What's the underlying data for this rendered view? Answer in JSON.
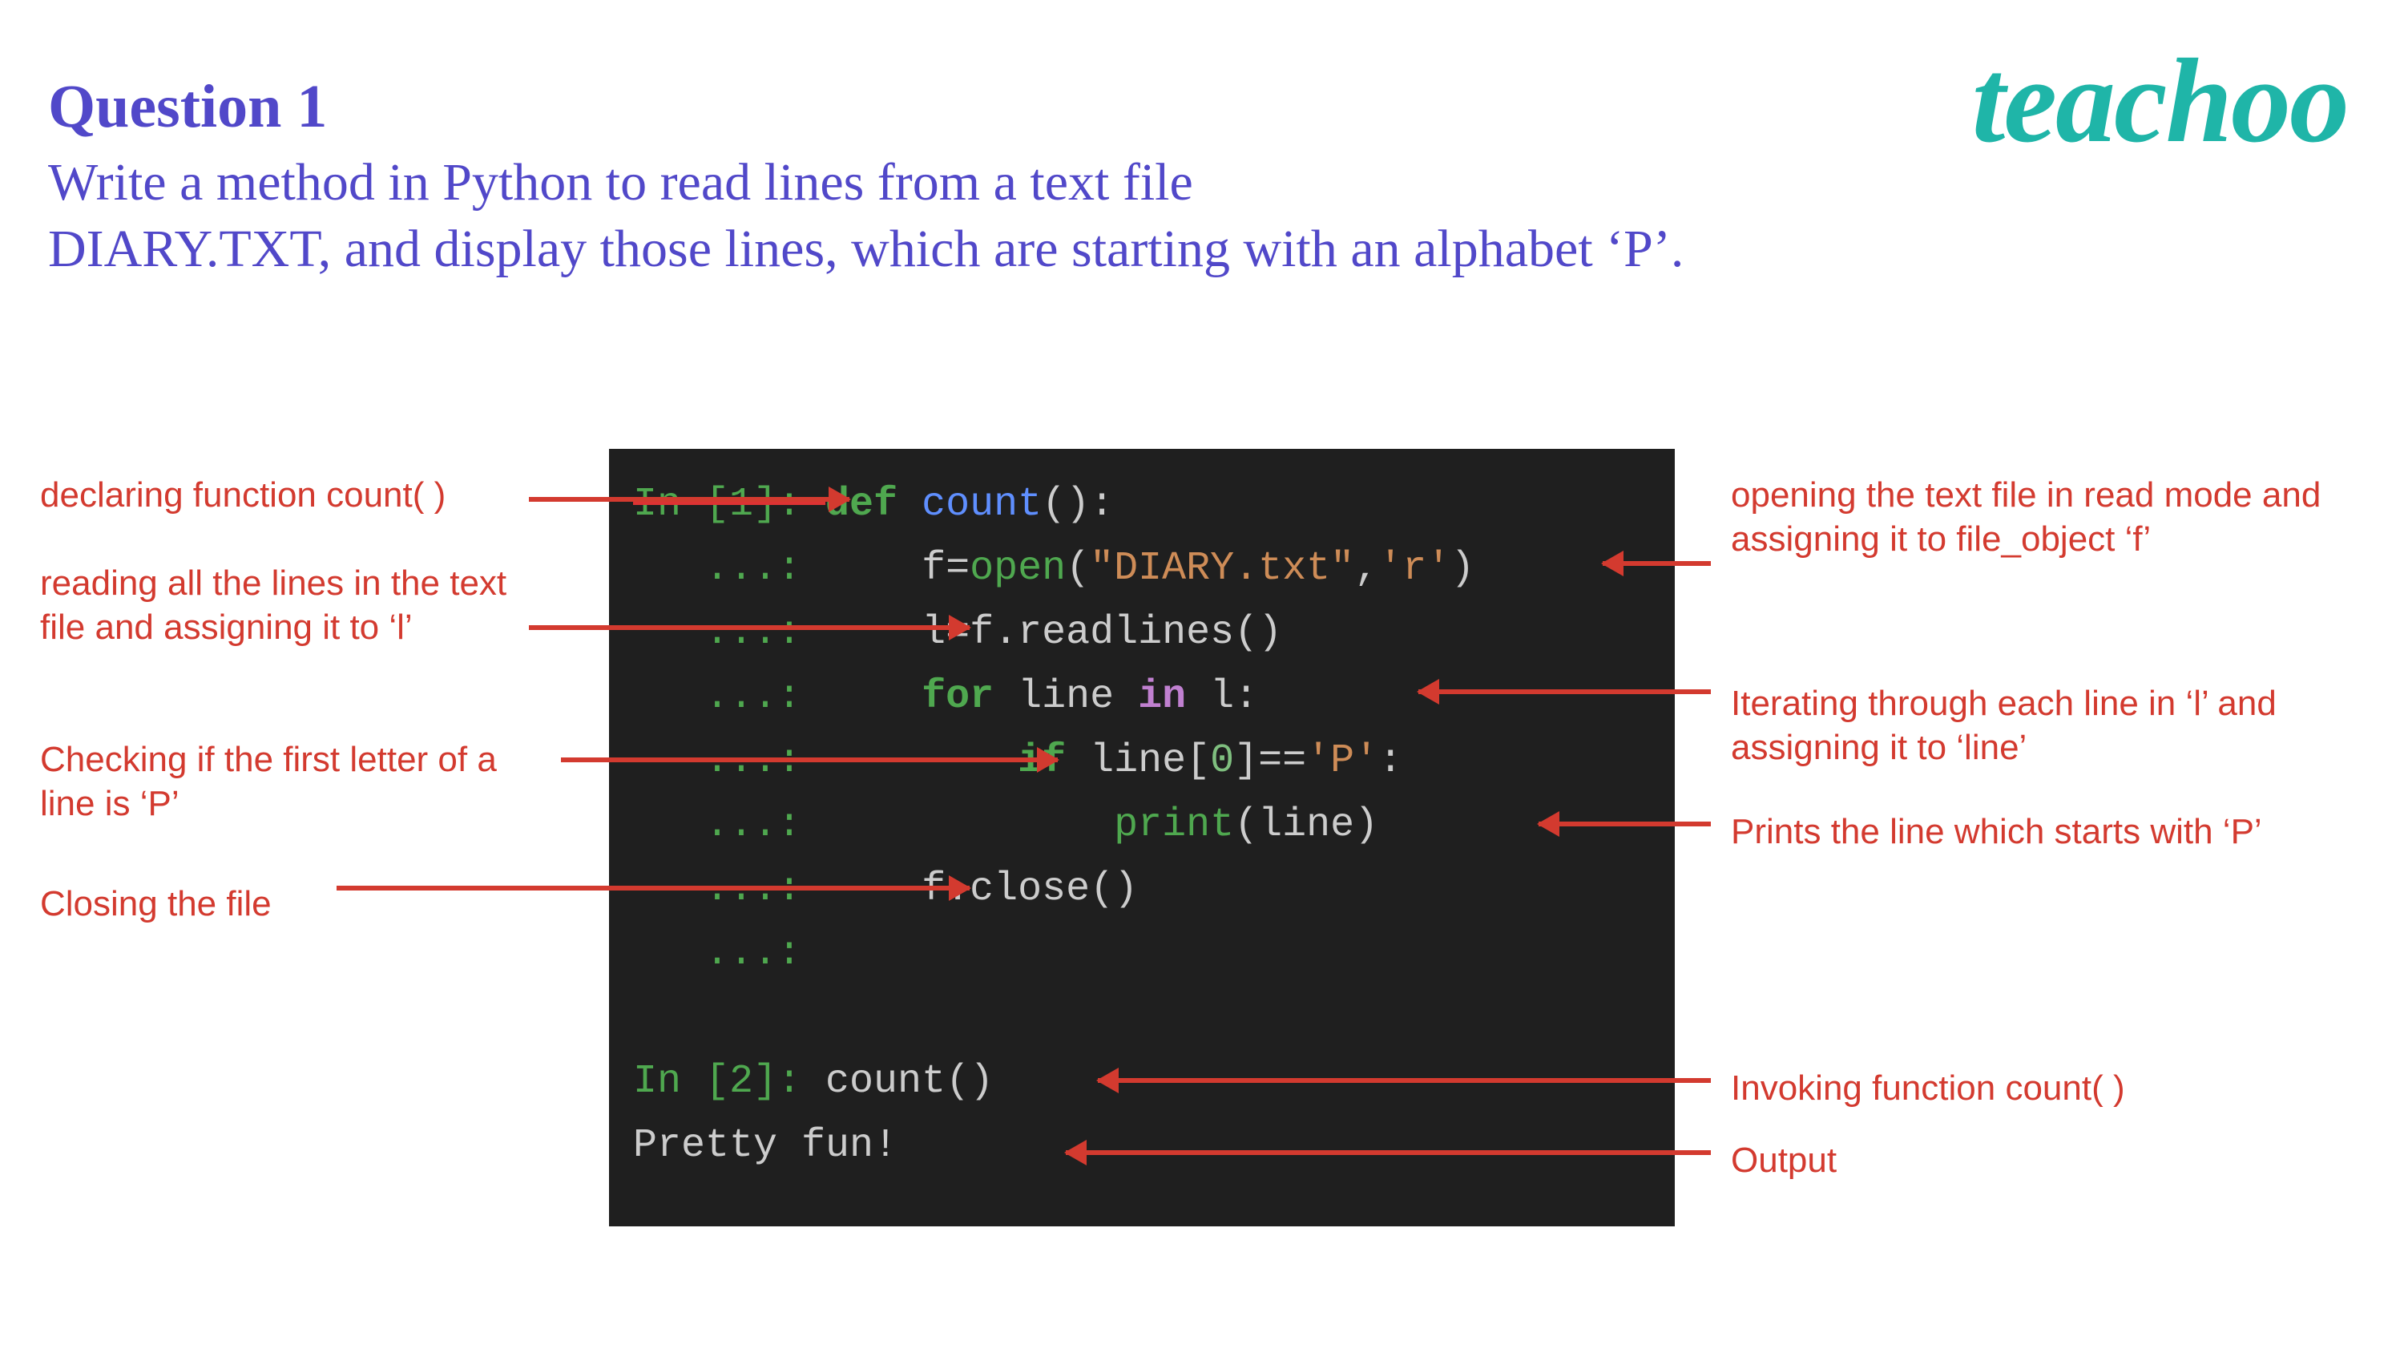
{
  "brand": "teachoo",
  "question": {
    "title": "Question 1",
    "body_line1": "Write a method in Python to read lines from a text  file",
    "body_line2": "DIARY.TXT, and display those lines, which  are starting with an alphabet ‘P’."
  },
  "code": {
    "prompt1": "In [1]: ",
    "def": "def ",
    "fn": "count",
    "paren_colon": "():",
    "cont": "   ...: ",
    "l2_a": "    f=",
    "l2_open": "open",
    "l2_b": "(",
    "l2_str1": "\"DIARY.txt\"",
    "l2_c": ",",
    "l2_str2": "'r'",
    "l2_d": ")",
    "l3": "    l=f.readlines()",
    "l4_for": "    for ",
    "l4_var": "line ",
    "l4_in": "in ",
    "l4_rest": "l:",
    "l5_if": "        if ",
    "l5_body_a": "line[",
    "l5_zero": "0",
    "l5_body_b": "]==",
    "l5_str": "'P'",
    "l5_body_c": ":",
    "l6_a": "            ",
    "l6_print": "print",
    "l6_b": "(line)",
    "l7": "    f.close()",
    "empty": "",
    "prompt2": "In [2]: ",
    "l9": "count()",
    "l10": "Pretty fun!"
  },
  "annotations": {
    "left1": "declaring function count( )",
    "left2": "reading all the lines in the text file and assigning it to ‘l’",
    "left3": "Checking if the first letter of a line is ‘P’",
    "left4": "Closing the file",
    "right1": "opening the text file in read mode and assigning it to file_object ‘f’",
    "right2": "Iterating through each line in ‘l’ and assigning it to ‘line’",
    "right3": "Prints the line which starts with ‘P’",
    "right4": "Invoking function count( )",
    "right5": "Output"
  }
}
